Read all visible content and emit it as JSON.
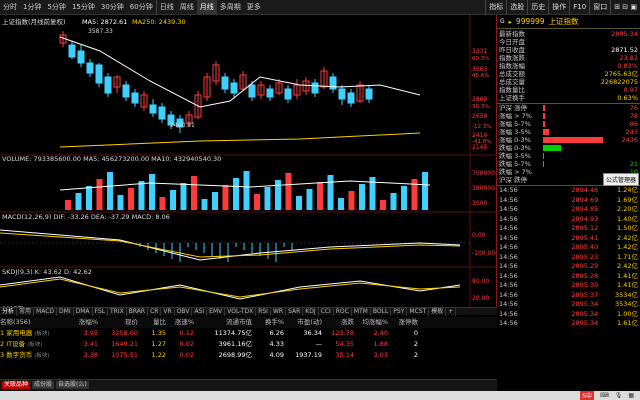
{
  "toolbar": {
    "periods": [
      "分时",
      "1分钟",
      "5分钟",
      "15分钟",
      "30分钟",
      "60分钟",
      "日线",
      "周线",
      "月线",
      "多周期",
      "更多"
    ],
    "active_period": "月线",
    "right_tools": [
      "指标",
      "选股",
      "历史",
      "操作",
      "F10",
      "窗口"
    ],
    "right_extra": "⊞  ⊟  ▣"
  },
  "chart": {
    "title": "上证指数(月线前复权)",
    "ma_line": "MA5: 2872.61  MA250: 2439.30",
    "ma5_label": "MA5: 2872.61",
    "ma250_label": "MA250: 2439.30",
    "high_label": "3587.33",
    "low_label": "2440.91",
    "price_axis": [
      "3331",
      "3063",
      "2865",
      "2659",
      "2410",
      "2145"
    ],
    "pct_axis": [
      "60.3%",
      "45.6%",
      "30.3%",
      "-12.3%",
      "-41.8%"
    ],
    "volume_line": "VOLUME: 793385600.00  MA5: 456273200.00  MA10: 432940540.30",
    "volume_axis": [
      "700000",
      "380000",
      "3000"
    ],
    "macd_line": "MACD(12,26,9) DIF: -33.26  DEA: -37.29  MACD: 8.06",
    "macd_axis": [
      "0.00",
      "-100.00"
    ],
    "kdj_line": "SKDJ(9,3)  K: 43.62  D: 42.62",
    "kdj_axis": [
      "80.00",
      "20.00"
    ],
    "date_axis": [
      "2017年",
      "",
      "",
      "",
      "",
      "",
      "",
      "",
      "",
      "",
      "",
      "",
      "",
      "",
      "",
      "",
      "",
      "",
      "",
      "",
      "",
      "",
      "",
      "",
      "",
      "",
      "",
      "",
      "",
      "",
      "",
      "",
      "",
      "",
      "",
      "",
      "",
      "",
      "",
      "",
      "",
      "",
      "",
      "2019年"
    ]
  },
  "tabs": [
    "分析",
    "常用",
    "MACD",
    "DMI",
    "DMA",
    "FSL",
    "TRIX",
    "BRAR",
    "CR",
    "VR",
    "OBV",
    "ASI",
    "EMV",
    "VOL-TDX",
    "RSI",
    "WR",
    "SAR",
    "KDJ",
    "CCI",
    "ROC",
    "MTM",
    "BOLL",
    "PSY",
    "MCST",
    "模板",
    "+"
  ],
  "table": {
    "headers": [
      "名称(356)",
      "涨幅%",
      "现价",
      "量比",
      "涨速%",
      "流通市值",
      "换手%",
      "市盈(动)",
      "涨跌",
      "均涨幅%",
      "涨停数"
    ],
    "rows": [
      {
        "idx": "1",
        "name": "家用电器",
        "tag": "(板块)",
        "pct": "3.95",
        "price": "3258.60",
        "vr": "1.35",
        "spd": "0.12",
        "mcap": "11374.75亿",
        "turn": "6.26",
        "pe": "36.34",
        "chg": "123.78",
        "avg": "2.40",
        "lim": "0"
      },
      {
        "idx": "2",
        "name": "IT设备",
        "tag": "(板块)",
        "pct": "3.41",
        "price": "1649.21",
        "vr": "1.27",
        "spd": "0.02",
        "mcap": "3961.16亿",
        "turn": "4.33",
        "pe": "—",
        "chg": "54.35",
        "avg": "1.88",
        "lim": "2"
      },
      {
        "idx": "3",
        "name": "数字货币",
        "tag": "(板块)",
        "pct": "3.38",
        "price": "1075.51",
        "vr": "1.22",
        "spd": "0.02",
        "mcap": "2698.99亿",
        "turn": "4.09",
        "pe": "1937.19",
        "chg": "35.14",
        "avg": "3.03",
        "lim": "2"
      }
    ]
  },
  "bottom_tabs": [
    "关联品种",
    "成份股",
    "自选股(么)"
  ],
  "status": {
    "left": "扩展",
    "mid": "关联报价"
  },
  "right_panel": {
    "code": "999999",
    "name": "上证指数",
    "quotes": [
      {
        "label": "最新指数",
        "value": "2895.34",
        "color": "red"
      },
      {
        "label": "今日开盘",
        "value": "",
        "color": "red"
      },
      {
        "label": "昨日收盘",
        "value": "2871.52",
        "color": "white"
      },
      {
        "label": "指数涨跌",
        "value": "23.82",
        "color": "red"
      },
      {
        "label": "指数涨幅",
        "value": "0.83%",
        "color": "red"
      },
      {
        "label": "总成交额",
        "value": "2765.63亿",
        "color": "yellow"
      },
      {
        "label": "总成交量",
        "value": "226822075",
        "color": "yellow"
      },
      {
        "label": "指数量比",
        "value": "0.97",
        "color": "red"
      },
      {
        "label": "上证换手",
        "value": "0.63%",
        "color": "yellow"
      }
    ],
    "dist": [
      {
        "label": "沪深 涨停",
        "value": "76",
        "color": "red",
        "bar": 0.03
      },
      {
        "label": "涨幅 > 7%",
        "value": "78",
        "color": "red",
        "bar": 0.03
      },
      {
        "label": "涨幅 5-7%",
        "value": "86",
        "color": "red",
        "bar": 0.04
      },
      {
        "label": "涨幅 3-5%",
        "value": "243",
        "color": "red",
        "bar": 0.1
      },
      {
        "label": "涨幅 0-3%",
        "value": "2436",
        "color": "red",
        "bar": 1.0
      },
      {
        "label": "跌幅 0-3%",
        "value": "",
        "color": "green",
        "bar": 0.3
      },
      {
        "label": "跌幅 3-5%",
        "value": "",
        "color": "green",
        "bar": 0.02
      },
      {
        "label": "跌幅 5-7%",
        "value": "21",
        "color": "green",
        "bar": 0.01
      },
      {
        "label": "跌幅 > 7%",
        "value": "10",
        "color": "green",
        "bar": 0.0
      },
      {
        "label": "沪深 跌停",
        "value": "",
        "color": "green",
        "bar": 0.0
      }
    ],
    "tooltip": "公式管理器",
    "ticks": [
      {
        "t": "14:56",
        "p": "2894.46",
        "v": "1.24亿"
      },
      {
        "t": "14:56",
        "p": "2894.69",
        "v": "1.69亿"
      },
      {
        "t": "14:56",
        "p": "2894.85",
        "v": "2.20亿"
      },
      {
        "t": "14:56",
        "p": "2894.93",
        "v": "1.40亿"
      },
      {
        "t": "14:56",
        "p": "2895.12",
        "v": "1.50亿"
      },
      {
        "t": "14:56",
        "p": "2895.41",
        "v": "2.42亿"
      },
      {
        "t": "14:56",
        "p": "2895.40",
        "v": "1.42亿"
      },
      {
        "t": "14:56",
        "p": "2895.23",
        "v": "1.71亿"
      },
      {
        "t": "14:56",
        "p": "2895.29",
        "v": "2.42亿"
      },
      {
        "t": "14:56",
        "p": "2895.28",
        "v": "1.41亿"
      },
      {
        "t": "14:56",
        "p": "2895.30",
        "v": "1.41亿"
      },
      {
        "t": "14:56",
        "p": "2895.37",
        "v": "3534亿"
      },
      {
        "t": "14:56",
        "p": "2895.34",
        "v": "3534亿"
      },
      {
        "t": "14:56",
        "p": "2895.34",
        "v": "1.00亿"
      },
      {
        "t": "14:56",
        "p": "2895.34",
        "v": "1.61亿"
      }
    ]
  },
  "taskbar": {
    "ime": "S中",
    "clock": ""
  }
}
